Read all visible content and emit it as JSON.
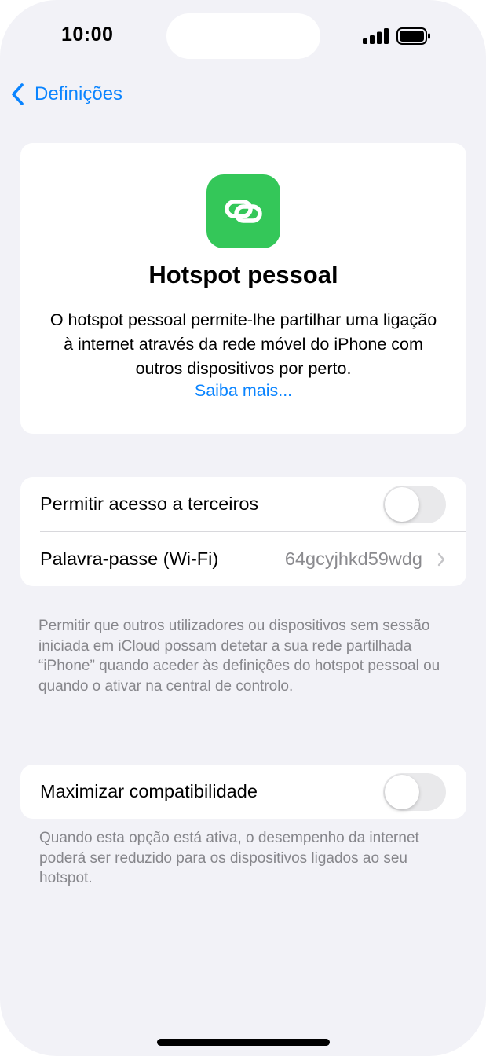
{
  "status_bar": {
    "time": "10:00",
    "signal_icon": "cellular-signal-icon",
    "battery_icon": "battery-full-icon"
  },
  "nav": {
    "back_label": "Definições",
    "back_icon": "chevron-left-icon"
  },
  "hero": {
    "icon": "link-icon",
    "icon_color": "#34c759",
    "title": "Hotspot pessoal",
    "description": "O hotspot pessoal permite-lhe partilhar uma ligação à internet através da rede móvel do iPhone com outros dispositivos por perto.",
    "link": "Saiba mais..."
  },
  "settings": {
    "allow_others_label": "Permitir acesso a terceiros",
    "allow_others_on": false,
    "password_label": "Palavra-passe (Wi-Fi)",
    "password_value": "64gcyjhkd59wdg",
    "allow_others_footnote": "Permitir que outros utilizadores ou dispositivos sem sessão iniciada em iCloud possam detetar a sua rede partilhada “iPhone” quando aceder às definições do hotspot pessoal ou quando o ativar na central de controlo.",
    "maximize_label": "Maximizar compatibilidade",
    "maximize_on": false,
    "maximize_footnote": "Quando esta opção está ativa, o desempenho da internet poderá ser reduzido para os dispositivos ligados ao seu hotspot."
  },
  "colors": {
    "accent": "#0a84ff",
    "background": "#f2f2f7",
    "toggle_off": "#e9e9eb"
  }
}
